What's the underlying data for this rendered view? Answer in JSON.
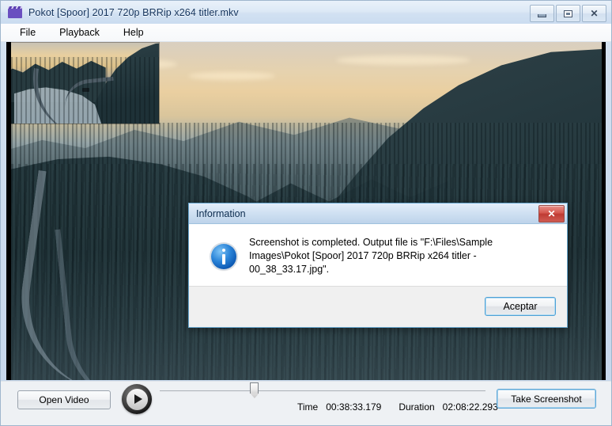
{
  "window": {
    "title": "Pokot [Spoor] 2017 720p BRRip x264 titler.mkv",
    "icon": "film-clapperboard-icon",
    "buttons": {
      "minimize": "minimize-icon",
      "maximize": "maximize-icon",
      "close": "✕"
    }
  },
  "menu": {
    "items": [
      {
        "label": "File"
      },
      {
        "label": "Playback"
      },
      {
        "label": "Help"
      }
    ]
  },
  "video": {
    "description": "winter mountain forest at dusk with curving snowy road",
    "overlay_thumbnail": "captured screenshot preview"
  },
  "controls": {
    "open_video_label": "Open Video",
    "play_icon": "play-icon",
    "take_screenshot_label": "Take Screenshot",
    "seek_position_percent": 29,
    "time_label": "Time",
    "time_value": "00:38:33.179",
    "duration_label": "Duration",
    "duration_value": "02:08:22.293"
  },
  "dialog": {
    "title": "Information",
    "close_glyph": "✕",
    "icon": "info-icon",
    "message": "Screenshot is completed. Output file is \"F:\\Files\\Sample Images\\Pokot [Spoor] 2017 720p BRRip x264 titler - 00_38_33.17.jpg\".",
    "ok_label": "Aceptar"
  },
  "colors": {
    "accent_blue": "#4ea1d6",
    "title_text": "#12325c",
    "close_red": "#bf3b33",
    "info_blue": "#0a55b0",
    "panel_bg": "#eef1f4"
  }
}
